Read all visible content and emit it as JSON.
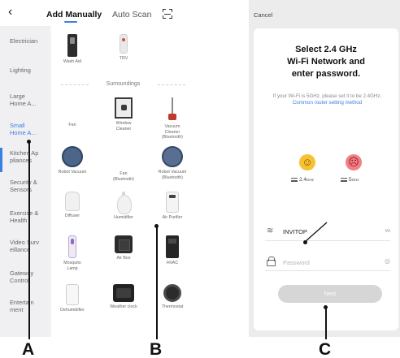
{
  "left_screen": {
    "tabs": {
      "manual": "Add Manually",
      "auto": "Auto Scan"
    },
    "categories": [
      "Electrician",
      "Lighting",
      "Large\nHome A...",
      "Small\nHome A...",
      "Kitchen Ap\npliances",
      "Security &\nSensors",
      "Exercise &\nHealth",
      "Video Surv\neillance",
      "Gateway\nControl",
      "Entertain\nment"
    ],
    "active_category": "Small\nHome A...",
    "top_devices": [
      "Wash Aid",
      "TRV"
    ],
    "section_title": "Surroundings",
    "devices": [
      "Fan",
      "Window\nCleaner",
      "Vacuum\nCleaner\n(Bluetooth)",
      "Robot Vacuum",
      "Fan\n(Bluetooth)",
      "Robot Vacuum\n(Bluetooth)",
      "Diffuser",
      "Humidifier",
      "Air Purifier",
      "Mosquito\nLamp",
      "Air Box",
      "HVAC",
      "Dehumidifier",
      "Weather clock",
      "Thermostat"
    ]
  },
  "right_screen": {
    "cancel": "Cancel",
    "title_lines": [
      "Select 2.4 GHz",
      "Wi-Fi Network and",
      "enter password."
    ],
    "hint": "If your Wi-Fi is 5GHz, please set it to be 2.4GHz.",
    "hint_link": "Common router setting method",
    "bands": {
      "good": "2.4",
      "good_unit": "GHz",
      "bad": "5",
      "bad_unit": "GHz"
    },
    "ssid": "INVITOP",
    "wifi_switch": "Wi",
    "password_placeholder": "Password",
    "next_button": "Next"
  },
  "callouts": {
    "a": "A",
    "b": "B",
    "c": "C"
  },
  "colors": {
    "accent": "#3b7fe0",
    "callout": "#111111",
    "good": "#f6c233",
    "bad": "#f27f86"
  }
}
